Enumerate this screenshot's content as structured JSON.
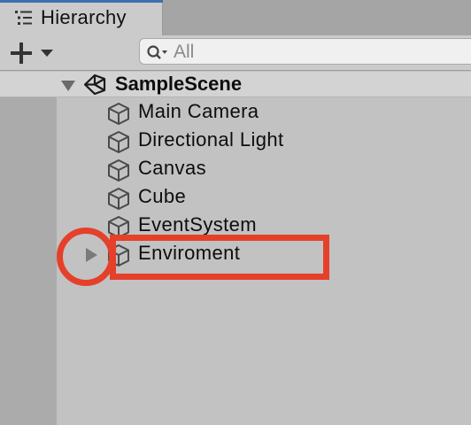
{
  "tab": {
    "title": "Hierarchy",
    "icon": "list-icon"
  },
  "toolbar": {
    "add_icon": "plus-icon",
    "dropdown_icon": "dropdown-arrow-icon"
  },
  "search": {
    "placeholder": "All",
    "value": "",
    "icon": "search-icon"
  },
  "scene": {
    "name": "SampleScene",
    "icon": "unity-icon",
    "expanded": true
  },
  "objects": [
    {
      "label": "Main Camera",
      "icon": "cube-icon",
      "has_children": false
    },
    {
      "label": "Directional Light",
      "icon": "cube-icon",
      "has_children": false
    },
    {
      "label": "Canvas",
      "icon": "cube-icon",
      "has_children": false
    },
    {
      "label": "Cube",
      "icon": "cube-icon",
      "has_children": false
    },
    {
      "label": "EventSystem",
      "icon": "cube-icon",
      "has_children": false
    },
    {
      "label": "Enviroment",
      "icon": "cube-icon",
      "has_children": true,
      "expanded": false
    }
  ],
  "colors": {
    "annotation": "#e5402a",
    "tab_accent": "#3a72b0",
    "panel_background": "#c2c2c2"
  }
}
